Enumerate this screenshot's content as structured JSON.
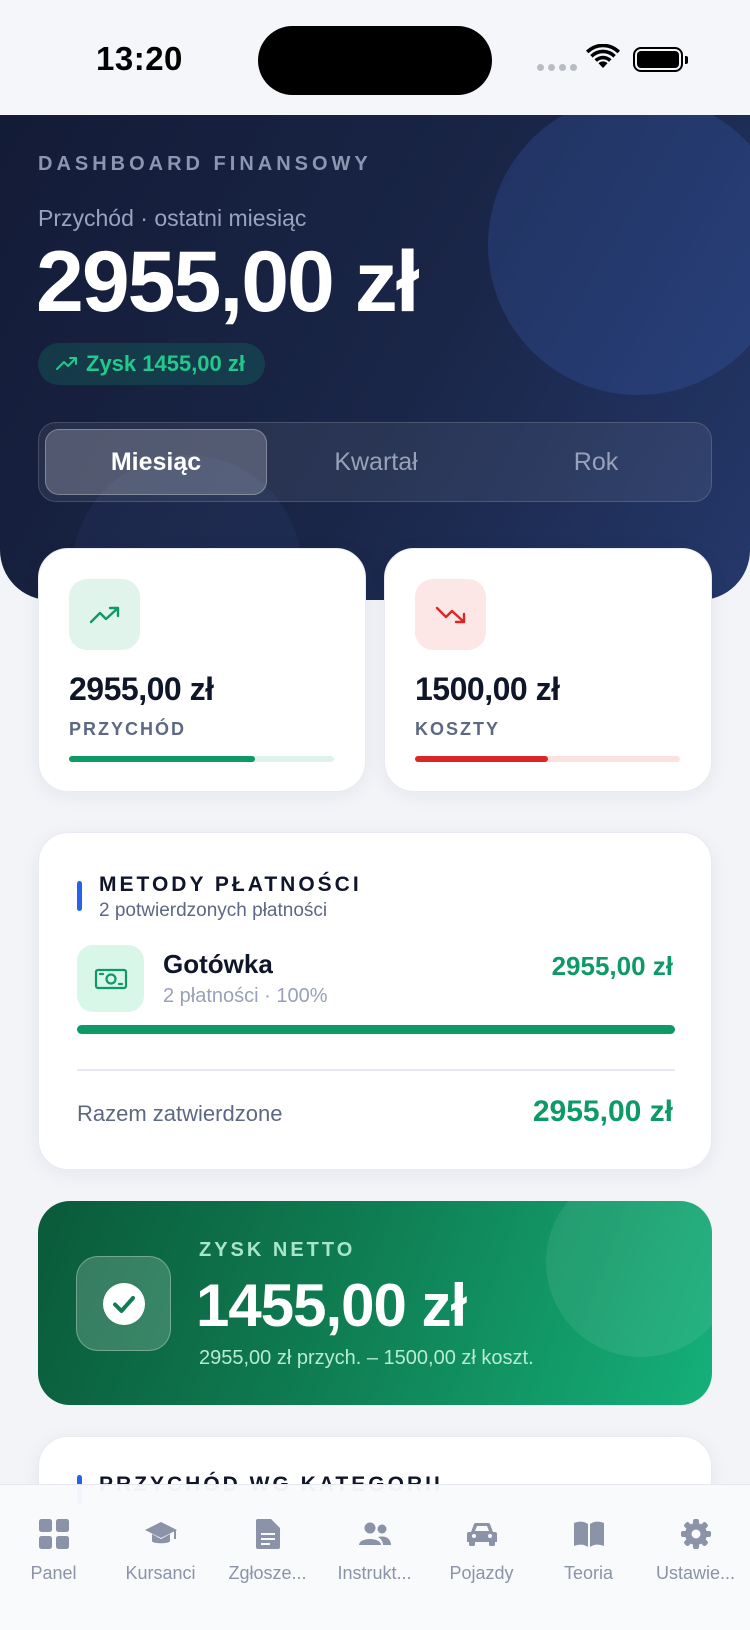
{
  "status_bar": {
    "time": "13:20"
  },
  "hero": {
    "eyebrow": "DASHBOARD FINANSOWY",
    "subtitle": "Przychód · ostatni miesiąc",
    "amount": "2955,00 zł",
    "profit_badge": "Zysk 1455,00 zł",
    "periods": [
      "Miesiąc",
      "Kwartał",
      "Rok"
    ],
    "selected_period": "Miesiąc"
  },
  "stats": {
    "revenue": {
      "value": "2955,00 zł",
      "label": "PRZYCHÓD",
      "progress": 0.7,
      "color": "#0d9a66",
      "track": "#dff3ea",
      "icon": "trending-up-icon"
    },
    "costs": {
      "value": "1500,00 zł",
      "label": "KOSZTY",
      "progress": 0.5,
      "color": "#dc2626",
      "track": "#fde1e1",
      "icon": "trending-down-icon"
    }
  },
  "payment_methods": {
    "title": "METODY PŁATNOŚCI",
    "subtitle": "2 potwierdzonych płatności",
    "items": [
      {
        "name": "Gotówka",
        "meta": "2 płatności · 100%",
        "value": "2955,00 zł",
        "share": 1.0,
        "icon": "cash-icon"
      }
    ],
    "total_label": "Razem zatwierdzone",
    "total_value": "2955,00 zł"
  },
  "net_profit": {
    "eyebrow": "ZYSK NETTO",
    "value": "1455,00 zł",
    "breakdown": "2955,00 zł przych. – 1500,00 zł koszt."
  },
  "next_section": {
    "title": "PRZYCHÓD WG KATEGORII"
  },
  "tab_bar": [
    {
      "label": "Panel",
      "icon": "grid-icon"
    },
    {
      "label": "Kursanci",
      "icon": "graduation-cap-icon"
    },
    {
      "label": "Zgłosze...",
      "icon": "document-icon"
    },
    {
      "label": "Instrukt...",
      "icon": "people-icon"
    },
    {
      "label": "Pojazdy",
      "icon": "car-icon"
    },
    {
      "label": "Teoria",
      "icon": "book-icon"
    },
    {
      "label": "Ustawie...",
      "icon": "gear-icon"
    }
  ]
}
